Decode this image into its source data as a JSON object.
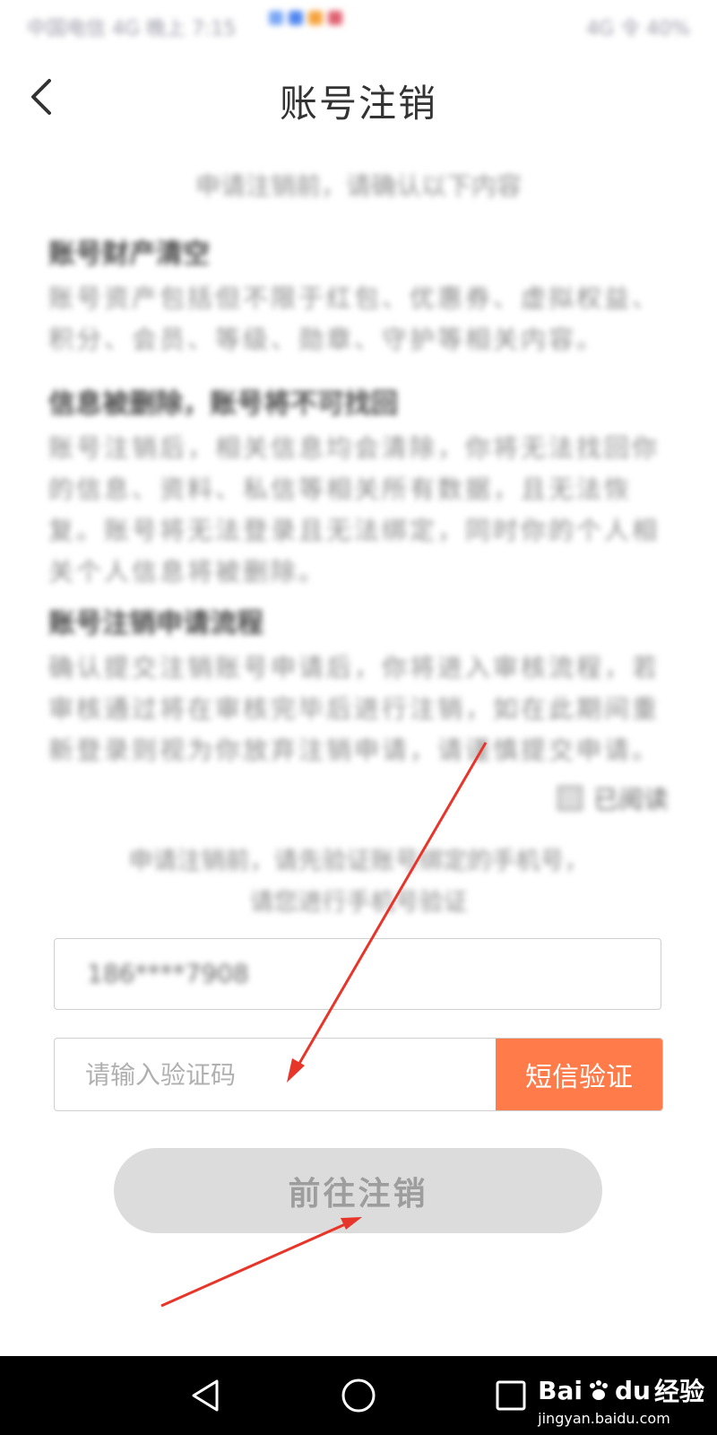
{
  "status_bar": {
    "left_text": "中国电信 4G 晚上 7:15",
    "right_text": "4G 令 40%",
    "icon_colors": [
      "#7aa7f5",
      "#4f86ef",
      "#f6a23b",
      "#e06070"
    ]
  },
  "header": {
    "title": "账号注销",
    "back_icon": "chevron-left-icon"
  },
  "intro": "申请注销前，请确认以下内容",
  "sections": [
    {
      "title": "账号财产清空",
      "body": "账号资产包括但不限于红包、优惠券、虚拟权益、积分、会员、等级、勋章、守护等相关内容。"
    },
    {
      "title": "信息被删除，账号将不可找回",
      "body": "账号注销后，相关信息均会清除，你将无法找回你的信息、资料、私信等相关所有数据，且无法恢复。账号将无法登录且无法绑定，同时你的个人相关个人信息将被删除。"
    },
    {
      "title": "账号注销申请流程",
      "body": "确认提交注销账号申请后，你将进入审核流程，若审核通过将在审核完毕后进行注销，如在此期间重新登录则视为你放弃注销申请，请谨慎提交申请。"
    }
  ],
  "agree": {
    "label": "已阅读"
  },
  "notice": {
    "line1": "申请注销前，请先验证账号绑定的手机号，",
    "line2": "请您进行手机号验证"
  },
  "phone_field": {
    "value": "186****7908"
  },
  "code_field": {
    "placeholder": "请输入验证码",
    "sms_label": "短信验证"
  },
  "submit": {
    "label": "前往注销"
  },
  "watermark": {
    "logo_text": "Bai",
    "logo_text_2": "du",
    "logo_cn": "经验",
    "url": "jingyan.baidu.com"
  },
  "colors": {
    "accent": "#ff7b4a",
    "disabled_button": "#dcdcdc",
    "arrow": "#e8352a"
  }
}
